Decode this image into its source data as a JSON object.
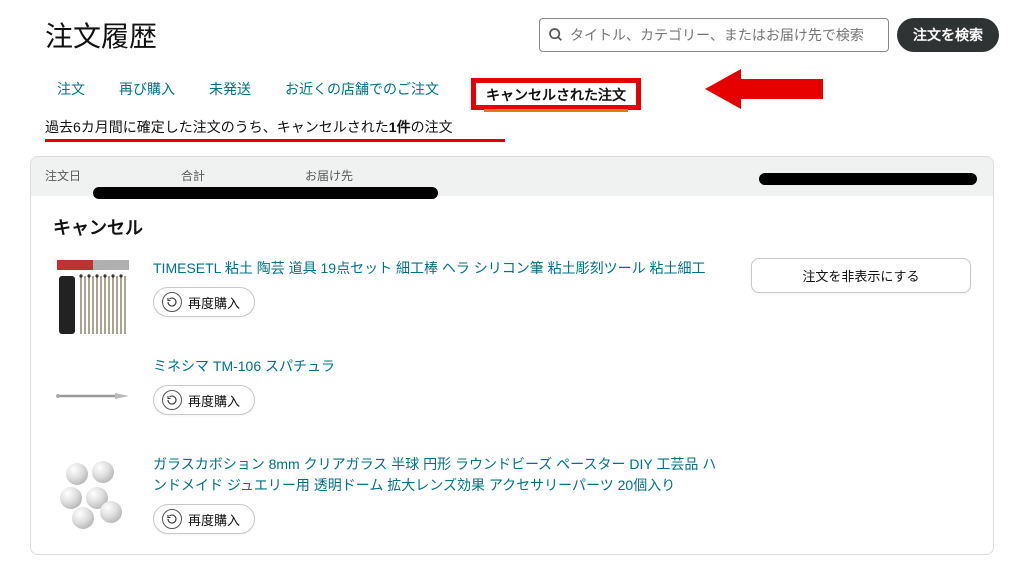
{
  "page": {
    "title": "注文履歴",
    "search_placeholder": "タイトル、カテゴリー、またはお届け先で検索",
    "search_button": "注文を検索"
  },
  "tabs": {
    "items": [
      {
        "label": "注文",
        "selected": false
      },
      {
        "label": "再び購入",
        "selected": false
      },
      {
        "label": "未発送",
        "selected": false
      },
      {
        "label": "お近くの店舗でのご注文",
        "selected": false
      },
      {
        "label": "キャンセルされた注文",
        "selected": true
      }
    ]
  },
  "summary": {
    "prefix": "過去6カ月間に確定した注文のうち、キャンセルされた",
    "count": "1件",
    "suffix": "の注文"
  },
  "order_header": {
    "date_label": "注文日",
    "total_label": "合計",
    "shipto_label": "お届け先"
  },
  "card": {
    "status_title": "キャンセル",
    "rebuy_label": "再度購入",
    "hide_label": "注文を非表示にする",
    "items": [
      {
        "title": "TIMESETL 粘土 陶芸 道具 19点セット 細工棒 ヘラ シリコン筆 粘土彫刻ツール 粘土細工"
      },
      {
        "title": "ミネシマ TM-106 スパチュラ"
      },
      {
        "title": "ガラスカボション 8mm クリアガラス 半球 円形 ラウンドビーズ ペースター DIY 工芸品 ハンドメイド ジュエリー用 透明ドーム 拡大レンズ効果 アクセサリーパーツ 20個入り"
      }
    ]
  }
}
